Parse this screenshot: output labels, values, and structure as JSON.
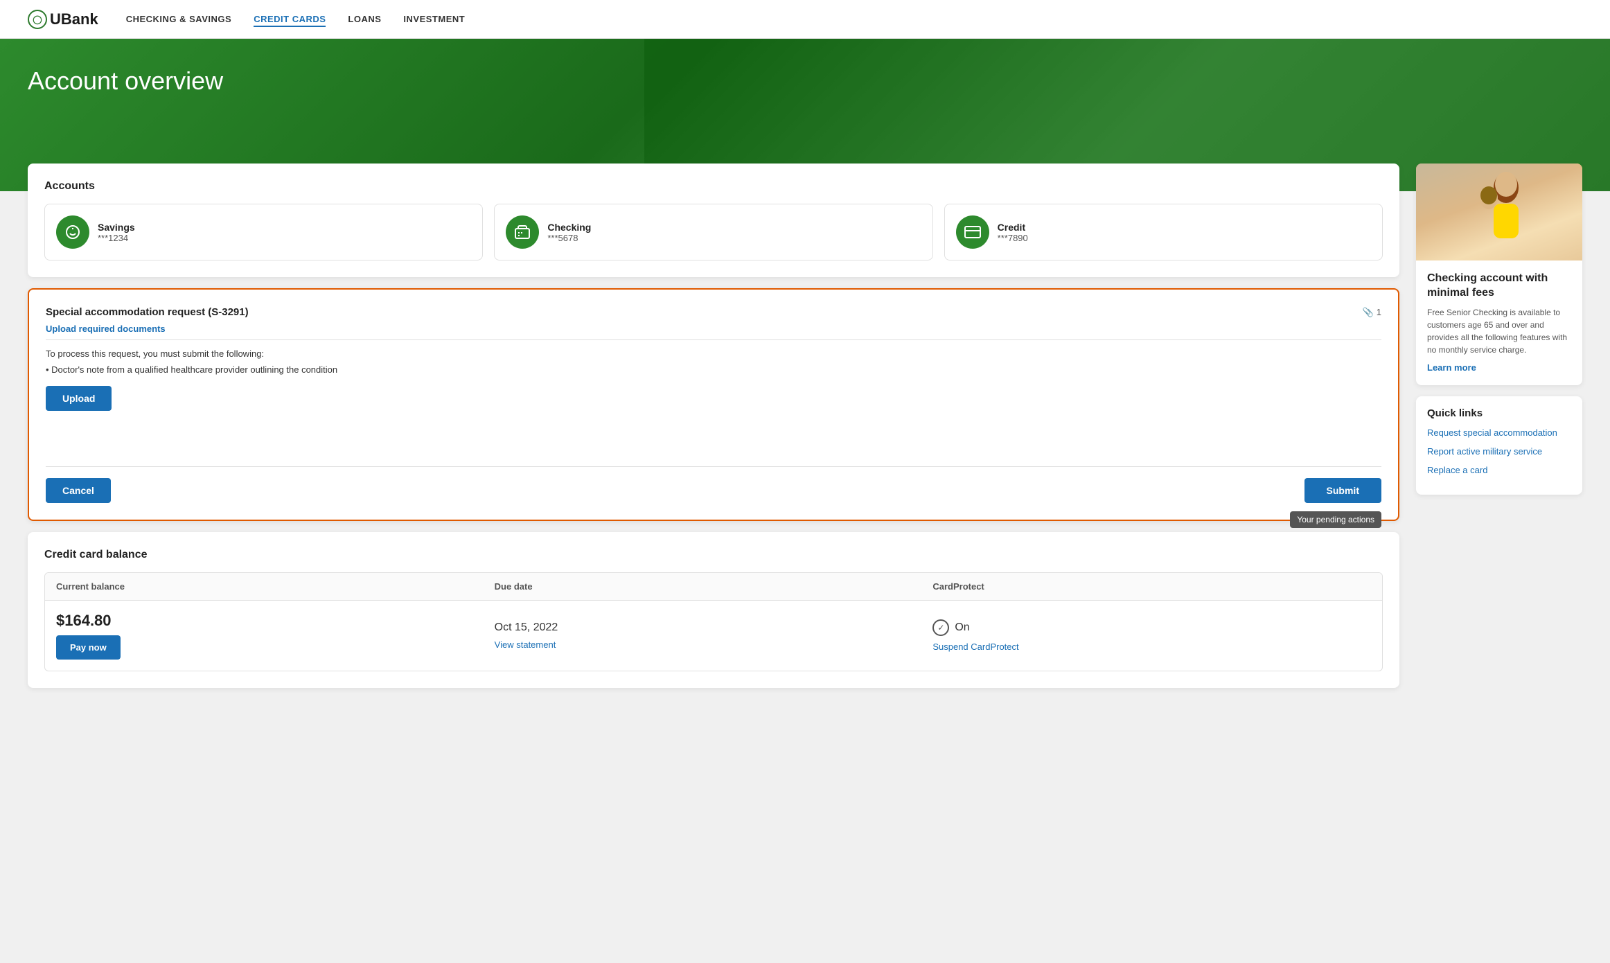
{
  "nav": {
    "logo_text": "UBank",
    "logo_icon": "U",
    "links": [
      {
        "id": "checking-savings",
        "label": "CHECKING & SAVINGS",
        "active": false
      },
      {
        "id": "credit-cards",
        "label": "CREDIT CARDS",
        "active": true
      },
      {
        "id": "loans",
        "label": "LOANS",
        "active": false
      },
      {
        "id": "investment",
        "label": "INVESTMENT",
        "active": false
      }
    ]
  },
  "hero": {
    "title": "Account overview"
  },
  "accounts": {
    "section_title": "Accounts",
    "items": [
      {
        "id": "savings",
        "name": "Savings",
        "number": "***1234",
        "icon": "piggy-bank"
      },
      {
        "id": "checking",
        "name": "Checking",
        "number": "***5678",
        "icon": "banknote"
      },
      {
        "id": "credit",
        "name": "Credit",
        "number": "***7890",
        "icon": "credit-card"
      }
    ]
  },
  "accommodation": {
    "title": "Special accommodation request (S-3291)",
    "attachment_count": "1",
    "section_label": "Upload required documents",
    "instruction": "To process this request, you must submit the following:",
    "doc_item": "• Doctor's note from a qualified healthcare provider outlining the condition",
    "upload_button": "Upload",
    "cancel_button": "Cancel",
    "submit_button": "Submit",
    "tooltip": "Your pending actions"
  },
  "credit_balance": {
    "title": "Credit card balance",
    "columns": [
      "Current balance",
      "Due date",
      "CardProtect"
    ],
    "balance": "$164.80",
    "due_date": "Oct 15, 2022",
    "cardprotect_label": "On",
    "pay_button": "Pay now",
    "statement_link": "View statement",
    "suspend_link": "Suspend CardProtect"
  },
  "promo": {
    "title": "Checking account with minimal fees",
    "description": "Free Senior Checking is available to customers age 65 and over and provides all the following features with no monthly service charge.",
    "learn_more": "Learn more"
  },
  "quick_links": {
    "title": "Quick links",
    "links": [
      {
        "id": "request-accommodation",
        "label": "Request special accommodation"
      },
      {
        "id": "report-military",
        "label": "Report active military service"
      },
      {
        "id": "replace-card",
        "label": "Replace a card"
      }
    ]
  },
  "pending_actions": {
    "label": "Your pending actions"
  }
}
